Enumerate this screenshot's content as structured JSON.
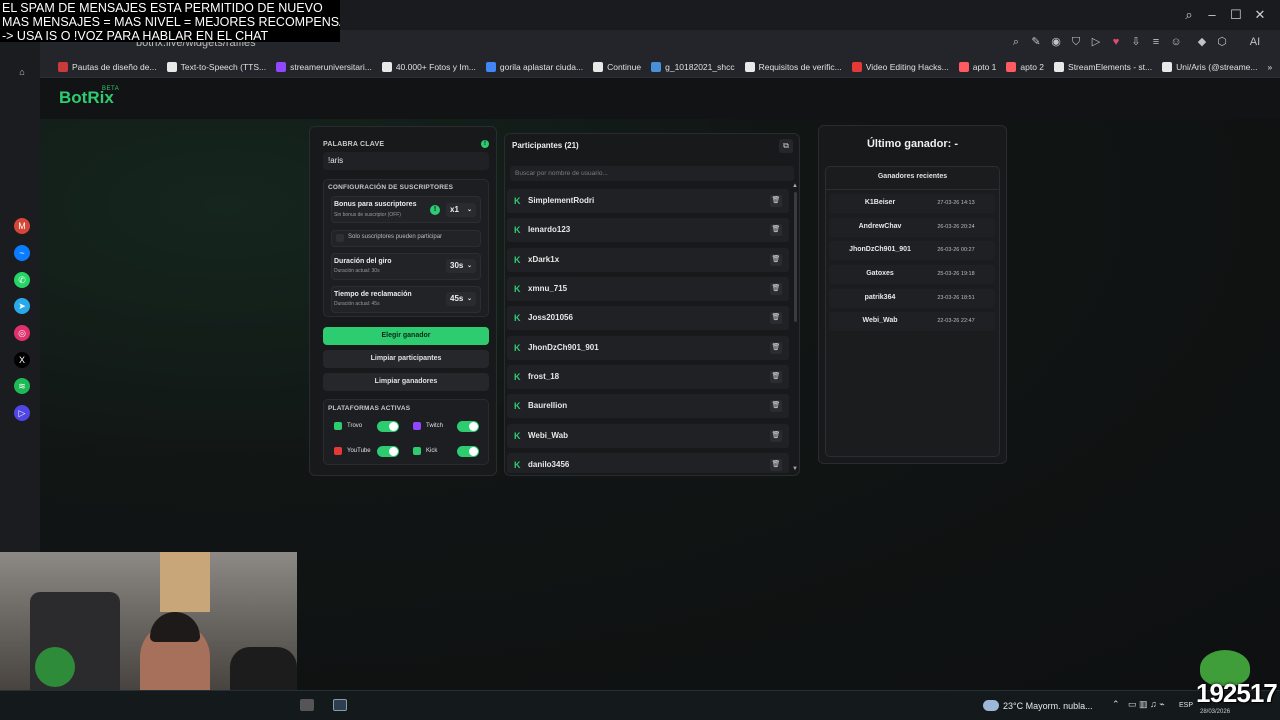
{
  "overlay": {
    "line1": "EL SPAM DE MENSAJES ESTA PERMITIDO DE NUEVO",
    "line2": "MAS MENSAJES = MAS NIVEL = MEJORES RECOMPENSAS",
    "line3": "-> USA IS  O !VOZ PARA HABLAR EN EL CHAT"
  },
  "browser": {
    "address": "botrix.live/widgets/raffles",
    "bookmarks": [
      {
        "label": "Pautas de diseño de...",
        "color": "#c83b3b"
      },
      {
        "label": "Text-to-Speech (TTS...",
        "color": "#e8e8e8"
      },
      {
        "label": "streameruniversitari...",
        "color": "#9146ff"
      },
      {
        "label": "40.000+ Fotos y Im...",
        "color": "#e8e8e8"
      },
      {
        "label": "gorila aplastar ciuda...",
        "color": "#4285f4"
      },
      {
        "label": "Continue",
        "color": "#e8e8e8"
      },
      {
        "label": "g_10182021_shcc",
        "color": "#4a90d9"
      },
      {
        "label": "Requisitos de verific...",
        "color": "#e8e8e8"
      },
      {
        "label": "Video Editing Hacks...",
        "color": "#e53935"
      },
      {
        "label": "apto 1",
        "color": "#ff5a5f"
      },
      {
        "label": "apto 2",
        "color": "#ff5a5f"
      },
      {
        "label": "StreamElements - st...",
        "color": "#e8e8e8"
      },
      {
        "label": "Uni/Aris (@streame...",
        "color": "#e8e8e8"
      }
    ]
  },
  "app": {
    "logo": "BotRix",
    "beta": "BETA"
  },
  "settings": {
    "keyword_label": "PALABRA CLAVE",
    "keyword_value": "!aris",
    "subs_title": "CONFIGURACIÓN DE SUSCRIPTORES",
    "bonus_title": "Bonus para suscriptores",
    "bonus_sub": "Sin bonus de suscriptor (OFF)",
    "bonus_value": "x1",
    "only_subs": "Solo suscriptores pueden participar",
    "spin_title": "Duración del giro",
    "spin_sub": "Duración actual: 30s",
    "spin_value": "30s",
    "claim_title": "Tiempo de reclamación",
    "claim_sub": "Duración actual: 45s",
    "claim_value": "45s",
    "btn_pick": "Elegir ganador",
    "btn_clear_participants": "Limpiar participantes",
    "btn_clear_winners": "Limpiar ganadores",
    "platforms_title": "PLATAFORMAS ACTIVAS",
    "platforms": [
      {
        "name": "Trovo",
        "color": "#2ecc71",
        "enabled": true
      },
      {
        "name": "Twitch",
        "color": "#9146ff",
        "enabled": true
      },
      {
        "name": "YouTube",
        "color": "#e53935",
        "enabled": true
      },
      {
        "name": "Kick",
        "color": "#2ecc71",
        "enabled": true
      }
    ]
  },
  "participants": {
    "title": "Participantes (21)",
    "search_placeholder": "Buscar por nombre de usuario...",
    "list": [
      "SimplementRodri",
      "lenardo123",
      "xDark1x",
      "xmnu_715",
      "Joss201056",
      "JhonDzCh901_901",
      "frost_18",
      "Baurellion",
      "Webi_Wab",
      "danilo3456"
    ]
  },
  "winners": {
    "title": "Último ganador: -",
    "recent_title": "Ganadores recientes",
    "list": [
      {
        "name": "K1Beiser",
        "date": "27-03-26 14:13"
      },
      {
        "name": "AndrewChav",
        "date": "26-03-26 20:24"
      },
      {
        "name": "JhonDzCh901_901",
        "date": "26-03-26 00:27"
      },
      {
        "name": "Gatoxes",
        "date": "25-03-26 19:18"
      },
      {
        "name": "patrik364",
        "date": "23-03-26 18:51"
      },
      {
        "name": "Webi_Wab",
        "date": "22-03-26 22:47"
      }
    ]
  },
  "taskbar": {
    "weather": "23°C  Mayorm. nubla...",
    "lang": "ESP",
    "date": "28/03/2026",
    "counter": "192517"
  }
}
